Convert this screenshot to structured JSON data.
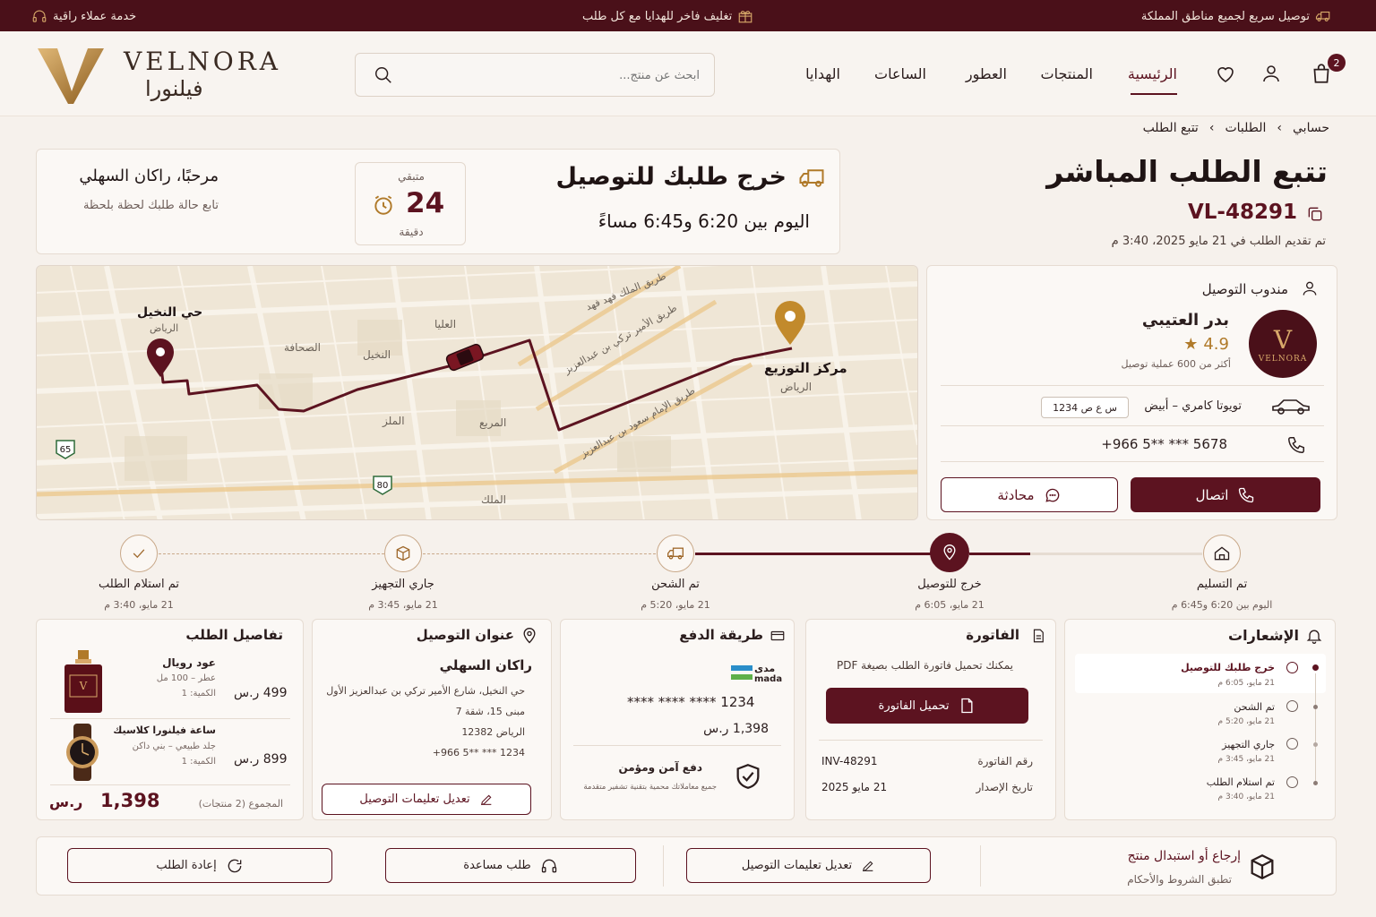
{
  "topbar": {
    "shipping": "توصيل سريع لجميع مناطق المملكة",
    "gift": "تغليف فاخر للهدايا مع كل طلب",
    "support": "خدمة عملاء راقية"
  },
  "brand": {
    "latin": "VELNORA",
    "arabic": "فيلنورا",
    "mark": "V"
  },
  "search": {
    "placeholder": "ابحث عن منتج..."
  },
  "nav": {
    "home": "الرئيسية",
    "products": "المنتجات",
    "perfumes": "العطور",
    "watches": "الساعات",
    "gifts": "الهدايا",
    "cart_count": "2"
  },
  "breadcrumb": {
    "account": "حسابي",
    "orders": "الطلبات",
    "tracking": "تتبع الطلب"
  },
  "page": {
    "title": "تتبع الطلب المباشر",
    "order_id": "VL-48291",
    "placed": "تم تقديم الطلب في 21 مايو 2025، 3:40 م"
  },
  "status": {
    "headline": "خرج طلبك للتوصيل",
    "window": "اليوم بين 6:20 و6:45 مساءً",
    "remaining_label": "متبقي",
    "remaining_value": "24",
    "remaining_unit": "دقيقة",
    "greeting": "مرحبًا، راكان السهلي",
    "greeting_sub": "تابع حالة طلبك لحظة بلحظة"
  },
  "map": {
    "labels": {
      "nakheel_district": "حي النخيل",
      "riyadh": "الرياض",
      "sahafa": "الصحافة",
      "olaya": "العليا",
      "nakheel": "النخيل",
      "malqa_top": "الملز",
      "murabba": "المربع",
      "malak": "الملك",
      "hub": "مركز التوزيع",
      "hub_city": "الرياض",
      "road1": "طريق الملك فهد فهد",
      "road2": "طريق الأمير تركي بن عبدالعزيز",
      "road3": "طريق الإمام سعود بن عبدالعزيز",
      "hw65": "65",
      "hw80": "80"
    }
  },
  "driver": {
    "section": "مندوب التوصيل",
    "name": "بدر العتيبي",
    "rating": "4.9",
    "deliveries": "أكثر من 600 عملية توصيل",
    "car": "تويوتا كامري – أبيض",
    "plate": "س ع ص 1234",
    "phone": "+966 5** *** 5678",
    "call": "اتصال",
    "chat": "محادثة",
    "avatar_text": "VELNORA"
  },
  "steps": [
    {
      "label": "تم التسليم",
      "date": "اليوم بين 6:20 و6:45 م"
    },
    {
      "label": "خرج للتوصيل",
      "date": "21 مايو، 6:05 م"
    },
    {
      "label": "تم الشحن",
      "date": "21 مايو، 5:20 م"
    },
    {
      "label": "جاري التجهيز",
      "date": "21 مايو، 3:45 م"
    },
    {
      "label": "تم استلام الطلب",
      "date": "21 مايو، 3:40 م"
    }
  ],
  "notifications": {
    "title": "الإشعارات",
    "items": [
      {
        "text": "خرج طلبك للتوصيل",
        "date": "21 مايو، 6:05 م"
      },
      {
        "text": "تم الشحن",
        "date": "21 مايو، 5:20 م"
      },
      {
        "text": "جاري التجهيز",
        "date": "21 مايو، 3:45 م"
      },
      {
        "text": "تم استلام الطلب",
        "date": "21 مايو، 3:40 م"
      }
    ]
  },
  "invoice": {
    "title": "الفاتورة",
    "desc": "يمكنك تحميل فاتورة الطلب بصيغة PDF",
    "download": "تحميل الفاتورة",
    "no_label": "رقم الفاتورة",
    "no_value": "INV-48291",
    "date_label": "تاريخ الإصدار",
    "date_value": "21 مايو 2025"
  },
  "payment": {
    "title": "طريقة الدفع",
    "brand_ar": "مدى",
    "brand_en": "mada",
    "card": "**** **** **** 1234",
    "amount": "1,398 ر.س",
    "secure_title": "دفع آمن ومؤمن",
    "secure_sub": "جميع معاملاتك محمية بتقنية تشفير متقدمة"
  },
  "address": {
    "title": "عنوان التوصيل",
    "name": "راكان السهلي",
    "line1": "حي النخيل، شارع الأمير تركي بن عبدالعزيز الأول",
    "line2": "مبنى 15، شقة 7",
    "line3": "الرياض 12382",
    "phone": "+966 5** *** 1234",
    "edit": "تعديل تعليمات التوصيل"
  },
  "order": {
    "title": "تفاصيل الطلب",
    "items": [
      {
        "name": "عود رويال",
        "sub": "عطر – 100 مل",
        "qty": "الكمية: 1",
        "price": "499 ر.س"
      },
      {
        "name": "ساعة فيلنورا كلاسيك",
        "sub": "جلد طبيعي – بني داكن",
        "qty": "الكمية: 1",
        "price": "899 ر.س"
      }
    ],
    "total_label": "المجموع (2 منتجات)",
    "total_value": "1,398",
    "currency": "ر.س"
  },
  "actions": {
    "return_title": "إرجاع أو استبدال منتج",
    "return_sub": "تطبق الشروط والأحكام",
    "edit": "تعديل تعليمات التوصيل",
    "help": "طلب مساعدة",
    "reorder": "إعادة الطلب"
  },
  "colors": {
    "maroon": "#5c1320",
    "gold": "#b07a2a",
    "bg": "#f6f1ec"
  }
}
